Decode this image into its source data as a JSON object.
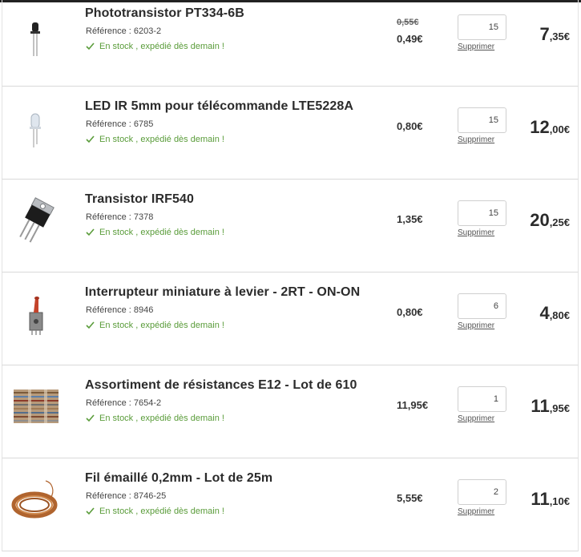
{
  "cart": {
    "items": [
      {
        "title": "Phototransistor PT334-6B",
        "reference": "Référence : 6203-2",
        "stock": "En stock , expédié dès demain !",
        "price_old": "0,55€",
        "price": "0,49€",
        "quantity": "15",
        "remove_label": "Supprimer",
        "total_int": "7",
        "total_dec": ",35€",
        "image_icon": "phototransistor-icon"
      },
      {
        "title": "LED IR 5mm pour télécommande LTE5228A",
        "reference": "Référence : 6785",
        "stock": "En stock , expédié dès demain !",
        "price_old": "",
        "price": "0,80€",
        "quantity": "15",
        "remove_label": "Supprimer",
        "total_int": "12",
        "total_dec": ",00€",
        "image_icon": "led-icon"
      },
      {
        "title": "Transistor IRF540",
        "reference": "Référence : 7378",
        "stock": "En stock , expédié dès demain !",
        "price_old": "",
        "price": "1,35€",
        "quantity": "15",
        "remove_label": "Supprimer",
        "total_int": "20",
        "total_dec": ",25€",
        "image_icon": "transistor-icon"
      },
      {
        "title": "Interrupteur miniature à levier - 2RT - ON-ON",
        "reference": "Référence : 8946",
        "stock": "En stock , expédié dès demain !",
        "price_old": "",
        "price": "0,80€",
        "quantity": "6",
        "remove_label": "Supprimer",
        "total_int": "4",
        "total_dec": ",80€",
        "image_icon": "toggle-switch-icon"
      },
      {
        "title": "Assortiment de résistances E12 - Lot de 610",
        "reference": "Référence : 7654-2",
        "stock": "En stock , expédié dès demain !",
        "price_old": "",
        "price": "11,95€",
        "quantity": "1",
        "remove_label": "Supprimer",
        "total_int": "11",
        "total_dec": ",95€",
        "image_icon": "resistor-kit-icon"
      },
      {
        "title": "Fil émaillé 0,2mm - Lot de 25m",
        "reference": "Référence : 8746-25",
        "stock": "En stock , expédié dès demain !",
        "price_old": "",
        "price": "5,55€",
        "quantity": "2",
        "remove_label": "Supprimer",
        "total_int": "11",
        "total_dec": ",10€",
        "image_icon": "copper-wire-icon"
      }
    ]
  },
  "colors": {
    "stock_green": "#5a9c3a",
    "text_dark": "#2b2b2b",
    "border": "#d9d9d9"
  }
}
